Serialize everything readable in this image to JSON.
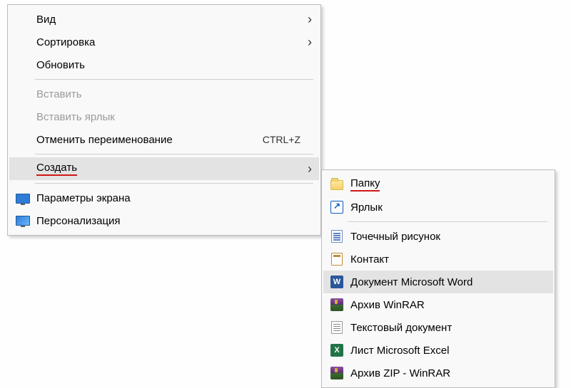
{
  "main_menu": {
    "view": "Вид",
    "sort": "Сортировка",
    "refresh": "Обновить",
    "paste": "Вставить",
    "paste_shortcut": "Вставить ярлык",
    "undo_rename": "Отменить переименование",
    "undo_rename_shortcut": "CTRL+Z",
    "create": "Создать",
    "display_settings": "Параметры экрана",
    "personalization": "Персонализация"
  },
  "sub_menu": {
    "folder": "Папку",
    "shortcut": "Ярлык",
    "bitmap": "Точечный рисунок",
    "contact": "Контакт",
    "word_doc": "Документ Microsoft Word",
    "winrar": "Архив WinRAR",
    "text_doc": "Текстовый документ",
    "excel": "Лист Microsoft Excel",
    "zip_winrar": "Архив ZIP - WinRAR"
  },
  "icon_letters": {
    "word": "W",
    "excel": "X"
  }
}
